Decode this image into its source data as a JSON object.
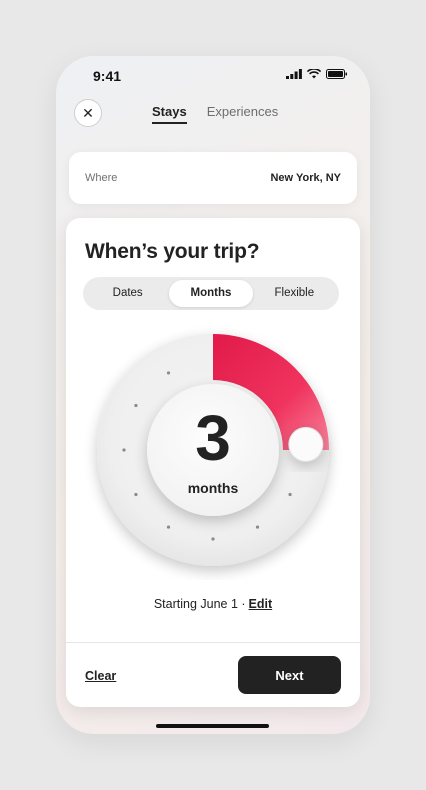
{
  "status_bar": {
    "time": "9:41"
  },
  "header": {
    "close_icon": "close-icon",
    "tabs": [
      {
        "label": "Stays",
        "active": true
      },
      {
        "label": "Experiences",
        "active": false
      }
    ]
  },
  "where": {
    "label": "Where",
    "value": "New York, NY"
  },
  "trip": {
    "title": "When’s your trip?",
    "modes": [
      {
        "label": "Dates",
        "active": false
      },
      {
        "label": "Months",
        "active": true
      },
      {
        "label": "Flexible",
        "active": false
      }
    ],
    "dial": {
      "value": "3",
      "unit": "months",
      "max": 12,
      "selected": 3
    },
    "starting_text": "Starting June 1 ·",
    "edit_label": "Edit"
  },
  "footer": {
    "clear_label": "Clear",
    "next_label": "Next"
  },
  "colors": {
    "accent": "#e51e4d",
    "accent_light": "#f33b64",
    "dark": "#222222"
  }
}
